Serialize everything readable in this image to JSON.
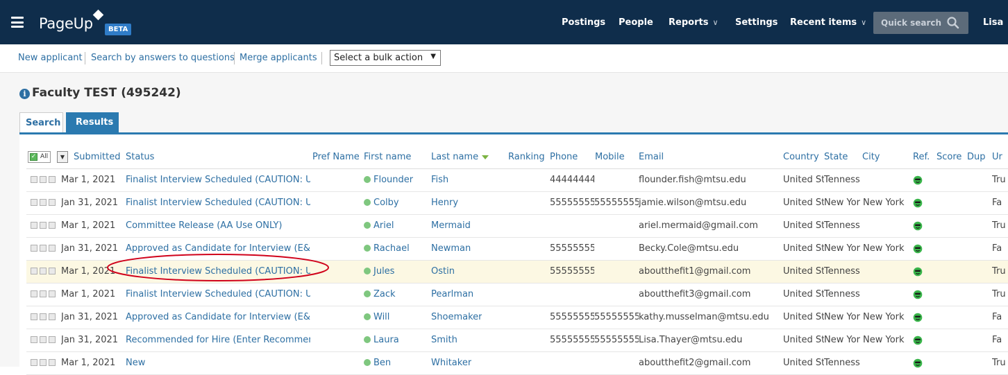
{
  "brand": {
    "name": "PageUp",
    "badge": "BETA"
  },
  "nav": {
    "postings": "Postings",
    "people": "People",
    "reports": "Reports",
    "settings": "Settings",
    "recent": "Recent items",
    "quick_search_placeholder": "Quick search",
    "user": "Lisa"
  },
  "toolbar": {
    "new_applicant": "New applicant",
    "search_answers": "Search by answers to questions",
    "merge": "Merge applicants",
    "bulk_action": "Select a bulk action"
  },
  "page": {
    "title": "Faculty TEST (495242)"
  },
  "tabs": {
    "search": "Search",
    "results": "Results"
  },
  "table": {
    "select_all": "All",
    "headers": {
      "submitted": "Submitted",
      "status": "Status",
      "pref_name": "Pref Name",
      "first_name": "First name",
      "last_name": "Last name",
      "ranking": "Ranking",
      "phone": "Phone",
      "mobile": "Mobile",
      "email": "Email",
      "country": "Country",
      "state": "State",
      "city": "City",
      "ref": "Ref.",
      "score": "Score",
      "dup": "Dup",
      "unsub": "Ur"
    },
    "rows": [
      {
        "submitted": "Mar 1, 2021",
        "status": "Finalist Interview Scheduled (CAUTION: Use f",
        "first": "Flounder",
        "last": "Fish",
        "phone": "44444444",
        "mobile": "",
        "email": "flounder.fish@mtsu.edu",
        "country": "United St",
        "state": "Tenness",
        "city": "",
        "unsub": "Tru"
      },
      {
        "submitted": "Jan 31, 2021",
        "status": "Finalist Interview Scheduled (CAUTION: Use f",
        "first": "Colby",
        "last": "Henry",
        "phone": "55555555",
        "mobile": "55555555",
        "email": "jamie.wilson@mtsu.edu",
        "country": "United St",
        "state": "New Yor",
        "city": "New York",
        "unsub": "Fa"
      },
      {
        "submitted": "Mar 1, 2021",
        "status": "Committee Release (AA Use ONLY)",
        "first": "Ariel",
        "last": "Mermaid",
        "phone": "",
        "mobile": "",
        "email": "ariel.mermaid@gmail.com",
        "country": "United St",
        "state": "Tenness",
        "city": "",
        "unsub": "Tru"
      },
      {
        "submitted": "Jan 31, 2021",
        "status": "Approved as Candidate for Interview (E&C U:",
        "first": "Rachael",
        "last": "Newman",
        "phone": "55555555",
        "mobile": "",
        "email": "Becky.Cole@mtsu.edu",
        "country": "United St",
        "state": "New Yor",
        "city": "New York",
        "unsub": "Fa"
      },
      {
        "submitted": "Mar 1, 2021",
        "status": "Finalist Interview Scheduled (CAUTION: Use f",
        "first": "Jules",
        "last": "Ostin",
        "phone": "55555555",
        "mobile": "",
        "email": "aboutthefit1@gmail.com",
        "country": "United St",
        "state": "Tenness",
        "city": "",
        "unsub": "Tru"
      },
      {
        "submitted": "Mar 1, 2021",
        "status": "Finalist Interview Scheduled (CAUTION: Use f",
        "first": "Zack",
        "last": "Pearlman",
        "phone": "",
        "mobile": "",
        "email": "aboutthefit3@gmail.com",
        "country": "United St",
        "state": "Tenness",
        "city": "",
        "unsub": "Tru"
      },
      {
        "submitted": "Jan 31, 2021",
        "status": "Approved as Candidate for Interview (E&C U:",
        "first": "Will",
        "last": "Shoemaker",
        "phone": "55555555",
        "mobile": "55555555",
        "email": "kathy.musselman@mtsu.edu",
        "country": "United St",
        "state": "New Yor",
        "city": "New York",
        "unsub": "Fa"
      },
      {
        "submitted": "Jan 31, 2021",
        "status": "Recommended for Hire (Enter Recommenda",
        "first": "Laura",
        "last": "Smith",
        "phone": "55555555",
        "mobile": "55555555",
        "email": "Lisa.Thayer@mtsu.edu",
        "country": "United St",
        "state": "New Yor",
        "city": "New York",
        "unsub": "Fa"
      },
      {
        "submitted": "Mar 1, 2021",
        "status": "New",
        "first": "Ben",
        "last": "Whitaker",
        "phone": "",
        "mobile": "",
        "email": "aboutthefit2@gmail.com",
        "country": "United St",
        "state": "Tenness",
        "city": "",
        "unsub": "Tru"
      }
    ]
  },
  "colors": {
    "nav_bg": "#0f2d4b",
    "link": "#2d6fa3",
    "tab_active": "#2b7ab0",
    "highlight_row": "#fcf8e3",
    "annotation": "#d0021b",
    "status_dot": "#7fc77f",
    "ref_icon": "#39b54a"
  },
  "highlight_row_index": 4
}
